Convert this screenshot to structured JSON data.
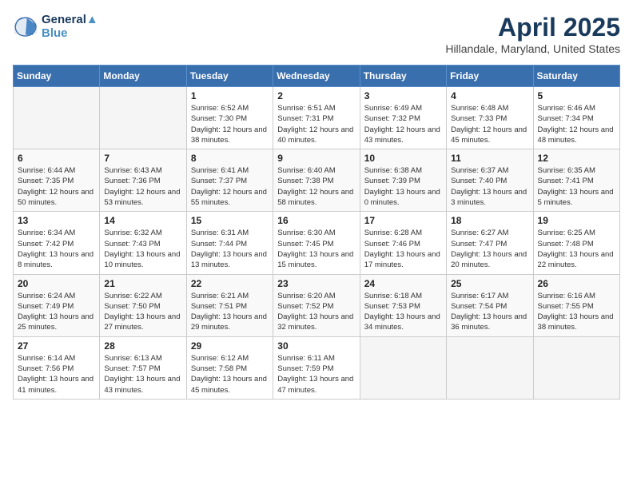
{
  "logo": {
    "line1": "General",
    "line2": "Blue"
  },
  "title": "April 2025",
  "location": "Hillandale, Maryland, United States",
  "weekdays": [
    "Sunday",
    "Monday",
    "Tuesday",
    "Wednesday",
    "Thursday",
    "Friday",
    "Saturday"
  ],
  "weeks": [
    [
      {
        "day": "",
        "empty": true
      },
      {
        "day": "",
        "empty": true
      },
      {
        "day": "1",
        "sunrise": "Sunrise: 6:52 AM",
        "sunset": "Sunset: 7:30 PM",
        "daylight": "Daylight: 12 hours and 38 minutes."
      },
      {
        "day": "2",
        "sunrise": "Sunrise: 6:51 AM",
        "sunset": "Sunset: 7:31 PM",
        "daylight": "Daylight: 12 hours and 40 minutes."
      },
      {
        "day": "3",
        "sunrise": "Sunrise: 6:49 AM",
        "sunset": "Sunset: 7:32 PM",
        "daylight": "Daylight: 12 hours and 43 minutes."
      },
      {
        "day": "4",
        "sunrise": "Sunrise: 6:48 AM",
        "sunset": "Sunset: 7:33 PM",
        "daylight": "Daylight: 12 hours and 45 minutes."
      },
      {
        "day": "5",
        "sunrise": "Sunrise: 6:46 AM",
        "sunset": "Sunset: 7:34 PM",
        "daylight": "Daylight: 12 hours and 48 minutes."
      }
    ],
    [
      {
        "day": "6",
        "sunrise": "Sunrise: 6:44 AM",
        "sunset": "Sunset: 7:35 PM",
        "daylight": "Daylight: 12 hours and 50 minutes."
      },
      {
        "day": "7",
        "sunrise": "Sunrise: 6:43 AM",
        "sunset": "Sunset: 7:36 PM",
        "daylight": "Daylight: 12 hours and 53 minutes."
      },
      {
        "day": "8",
        "sunrise": "Sunrise: 6:41 AM",
        "sunset": "Sunset: 7:37 PM",
        "daylight": "Daylight: 12 hours and 55 minutes."
      },
      {
        "day": "9",
        "sunrise": "Sunrise: 6:40 AM",
        "sunset": "Sunset: 7:38 PM",
        "daylight": "Daylight: 12 hours and 58 minutes."
      },
      {
        "day": "10",
        "sunrise": "Sunrise: 6:38 AM",
        "sunset": "Sunset: 7:39 PM",
        "daylight": "Daylight: 13 hours and 0 minutes."
      },
      {
        "day": "11",
        "sunrise": "Sunrise: 6:37 AM",
        "sunset": "Sunset: 7:40 PM",
        "daylight": "Daylight: 13 hours and 3 minutes."
      },
      {
        "day": "12",
        "sunrise": "Sunrise: 6:35 AM",
        "sunset": "Sunset: 7:41 PM",
        "daylight": "Daylight: 13 hours and 5 minutes."
      }
    ],
    [
      {
        "day": "13",
        "sunrise": "Sunrise: 6:34 AM",
        "sunset": "Sunset: 7:42 PM",
        "daylight": "Daylight: 13 hours and 8 minutes."
      },
      {
        "day": "14",
        "sunrise": "Sunrise: 6:32 AM",
        "sunset": "Sunset: 7:43 PM",
        "daylight": "Daylight: 13 hours and 10 minutes."
      },
      {
        "day": "15",
        "sunrise": "Sunrise: 6:31 AM",
        "sunset": "Sunset: 7:44 PM",
        "daylight": "Daylight: 13 hours and 13 minutes."
      },
      {
        "day": "16",
        "sunrise": "Sunrise: 6:30 AM",
        "sunset": "Sunset: 7:45 PM",
        "daylight": "Daylight: 13 hours and 15 minutes."
      },
      {
        "day": "17",
        "sunrise": "Sunrise: 6:28 AM",
        "sunset": "Sunset: 7:46 PM",
        "daylight": "Daylight: 13 hours and 17 minutes."
      },
      {
        "day": "18",
        "sunrise": "Sunrise: 6:27 AM",
        "sunset": "Sunset: 7:47 PM",
        "daylight": "Daylight: 13 hours and 20 minutes."
      },
      {
        "day": "19",
        "sunrise": "Sunrise: 6:25 AM",
        "sunset": "Sunset: 7:48 PM",
        "daylight": "Daylight: 13 hours and 22 minutes."
      }
    ],
    [
      {
        "day": "20",
        "sunrise": "Sunrise: 6:24 AM",
        "sunset": "Sunset: 7:49 PM",
        "daylight": "Daylight: 13 hours and 25 minutes."
      },
      {
        "day": "21",
        "sunrise": "Sunrise: 6:22 AM",
        "sunset": "Sunset: 7:50 PM",
        "daylight": "Daylight: 13 hours and 27 minutes."
      },
      {
        "day": "22",
        "sunrise": "Sunrise: 6:21 AM",
        "sunset": "Sunset: 7:51 PM",
        "daylight": "Daylight: 13 hours and 29 minutes."
      },
      {
        "day": "23",
        "sunrise": "Sunrise: 6:20 AM",
        "sunset": "Sunset: 7:52 PM",
        "daylight": "Daylight: 13 hours and 32 minutes."
      },
      {
        "day": "24",
        "sunrise": "Sunrise: 6:18 AM",
        "sunset": "Sunset: 7:53 PM",
        "daylight": "Daylight: 13 hours and 34 minutes."
      },
      {
        "day": "25",
        "sunrise": "Sunrise: 6:17 AM",
        "sunset": "Sunset: 7:54 PM",
        "daylight": "Daylight: 13 hours and 36 minutes."
      },
      {
        "day": "26",
        "sunrise": "Sunrise: 6:16 AM",
        "sunset": "Sunset: 7:55 PM",
        "daylight": "Daylight: 13 hours and 38 minutes."
      }
    ],
    [
      {
        "day": "27",
        "sunrise": "Sunrise: 6:14 AM",
        "sunset": "Sunset: 7:56 PM",
        "daylight": "Daylight: 13 hours and 41 minutes."
      },
      {
        "day": "28",
        "sunrise": "Sunrise: 6:13 AM",
        "sunset": "Sunset: 7:57 PM",
        "daylight": "Daylight: 13 hours and 43 minutes."
      },
      {
        "day": "29",
        "sunrise": "Sunrise: 6:12 AM",
        "sunset": "Sunset: 7:58 PM",
        "daylight": "Daylight: 13 hours and 45 minutes."
      },
      {
        "day": "30",
        "sunrise": "Sunrise: 6:11 AM",
        "sunset": "Sunset: 7:59 PM",
        "daylight": "Daylight: 13 hours and 47 minutes."
      },
      {
        "day": "",
        "empty": true
      },
      {
        "day": "",
        "empty": true
      },
      {
        "day": "",
        "empty": true
      }
    ]
  ]
}
